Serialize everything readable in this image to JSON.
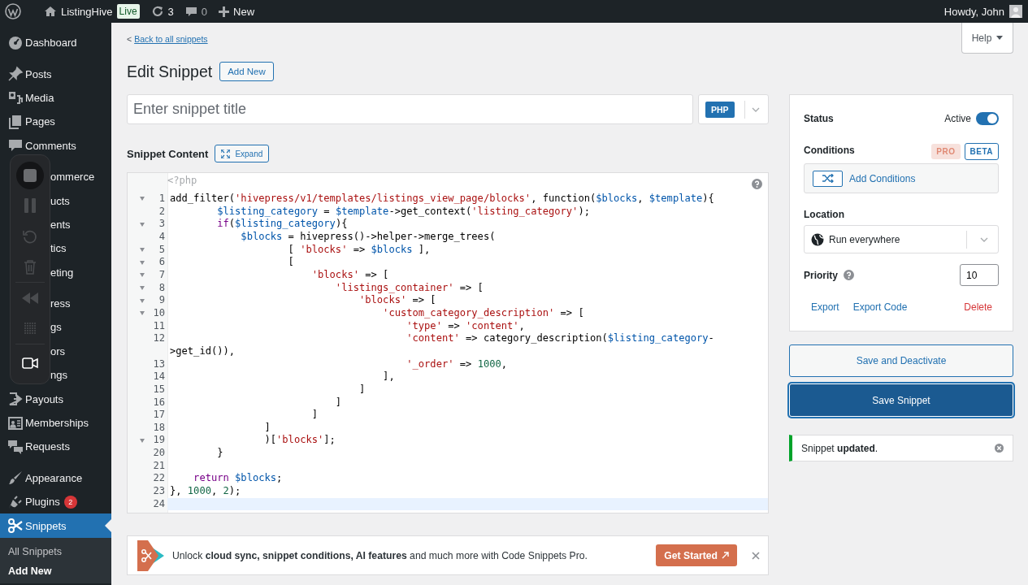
{
  "admin_bar": {
    "site_name": "ListingHive",
    "badge": "Live",
    "updates": "3",
    "comments": "0",
    "new": "New",
    "greeting": "Howdy, John"
  },
  "sidebar": {
    "groups": [
      {
        "items": [
          {
            "label": "Dashboard",
            "selected": false
          }
        ]
      },
      {
        "items": [
          {
            "label": "Posts",
            "selected": false
          },
          {
            "label": "Media",
            "selected": false
          },
          {
            "label": "Pages",
            "selected": false
          },
          {
            "label": "Comments",
            "selected": false
          }
        ]
      },
      {
        "items": [
          {
            "label": "ommerce",
            "selected": false
          },
          {
            "label": "ucts",
            "selected": false
          },
          {
            "label": "ents",
            "selected": false
          },
          {
            "label": "tics",
            "selected": false
          },
          {
            "label": "eting",
            "selected": false
          }
        ]
      },
      {
        "items": [
          {
            "label": "ress",
            "selected": false
          },
          {
            "label": "gs",
            "selected": false
          },
          {
            "label": "ors",
            "selected": false
          },
          {
            "label": "ngs",
            "selected": false
          },
          {
            "label": "Payouts",
            "selected": false
          },
          {
            "label": "Memberships",
            "selected": false
          },
          {
            "label": "Requests",
            "selected": false
          }
        ]
      },
      {
        "items": [
          {
            "label": "Appearance",
            "selected": false
          },
          {
            "label": "Plugins",
            "selected": false,
            "badge": "2"
          },
          {
            "label": "Snippets",
            "selected": true,
            "children": [
              {
                "label": "All Snippets",
                "selected": false
              },
              {
                "label": "Add New",
                "selected": true
              }
            ]
          }
        ]
      }
    ]
  },
  "header": {
    "back_prefix": "<",
    "back_link": "Back to all snippets",
    "help": "Help",
    "title": "Edit Snippet",
    "add_new": "Add New"
  },
  "title_field": {
    "placeholder": "Enter snippet title"
  },
  "type_select": {
    "value": "PHP"
  },
  "content_label": "Snippet Content",
  "expand_button": "Expand",
  "editor": {
    "opening_tag": "<?php",
    "lines": [
      {
        "num": "1",
        "fold": true,
        "current": false,
        "tokens": [
          {
            "kind": "plain",
            "text": "add_filter("
          },
          {
            "kind": "str",
            "text": "'hivepress/v1/templates/listings_view_page/blocks'"
          },
          {
            "kind": "plain",
            "text": ", function("
          },
          {
            "kind": "var",
            "text": "$blocks"
          },
          {
            "kind": "plain",
            "text": ", "
          },
          {
            "kind": "var",
            "text": "$template"
          },
          {
            "kind": "plain",
            "text": "){"
          }
        ]
      },
      {
        "num": "2",
        "fold": false,
        "current": false,
        "tokens": [
          {
            "kind": "var",
            "text": "        $listing_category"
          },
          {
            "kind": "plain",
            "text": " = "
          },
          {
            "kind": "var",
            "text": "$template"
          },
          {
            "kind": "plain",
            "text": "->get_context("
          },
          {
            "kind": "str",
            "text": "'listing_category'"
          },
          {
            "kind": "plain",
            "text": ");"
          }
        ]
      },
      {
        "num": "3",
        "fold": true,
        "current": false,
        "tokens": [
          {
            "kind": "kw",
            "text": "        if"
          },
          {
            "kind": "plain",
            "text": "("
          },
          {
            "kind": "var",
            "text": "$listing_category"
          },
          {
            "kind": "plain",
            "text": "){"
          }
        ]
      },
      {
        "num": "4",
        "fold": false,
        "current": false,
        "tokens": [
          {
            "kind": "var",
            "text": "            $blocks"
          },
          {
            "kind": "plain",
            "text": " = hivepress()->helper->merge_trees("
          }
        ]
      },
      {
        "num": "5",
        "fold": true,
        "current": false,
        "tokens": [
          {
            "kind": "plain",
            "text": "                    [ "
          },
          {
            "kind": "str",
            "text": "'blocks'"
          },
          {
            "kind": "plain",
            "text": " => "
          },
          {
            "kind": "var",
            "text": "$blocks"
          },
          {
            "kind": "plain",
            "text": " ],"
          }
        ]
      },
      {
        "num": "6",
        "fold": true,
        "current": false,
        "tokens": [
          {
            "kind": "plain",
            "text": "                    ["
          }
        ]
      },
      {
        "num": "7",
        "fold": true,
        "current": false,
        "tokens": [
          {
            "kind": "str",
            "text": "                        'blocks'"
          },
          {
            "kind": "plain",
            "text": " => ["
          }
        ]
      },
      {
        "num": "8",
        "fold": true,
        "current": false,
        "tokens": [
          {
            "kind": "str",
            "text": "                            'listings_container'"
          },
          {
            "kind": "plain",
            "text": " => ["
          }
        ]
      },
      {
        "num": "9",
        "fold": true,
        "current": false,
        "tokens": [
          {
            "kind": "str",
            "text": "                                'blocks'"
          },
          {
            "kind": "plain",
            "text": " => ["
          }
        ]
      },
      {
        "num": "10",
        "fold": true,
        "current": false,
        "tokens": [
          {
            "kind": "str",
            "text": "                                    'custom_category_description'"
          },
          {
            "kind": "plain",
            "text": " => ["
          }
        ]
      },
      {
        "num": "11",
        "fold": false,
        "current": false,
        "tokens": [
          {
            "kind": "str",
            "text": "                                        'type'"
          },
          {
            "kind": "plain",
            "text": " => "
          },
          {
            "kind": "str",
            "text": "'content'"
          },
          {
            "kind": "plain",
            "text": ","
          }
        ]
      },
      {
        "num": "12",
        "fold": false,
        "current": false,
        "tokens": [
          {
            "kind": "str",
            "text": "                                        'content'"
          },
          {
            "kind": "plain",
            "text": " => category_description("
          },
          {
            "kind": "var",
            "text": "$listing_category"
          },
          {
            "kind": "plain",
            "text": "-"
          }
        ]
      },
      {
        "fold": false,
        "current": false,
        "tokens": [
          {
            "kind": "plain",
            "text": ">get_id()),"
          }
        ]
      },
      {
        "num": "13",
        "fold": false,
        "current": false,
        "tokens": [
          {
            "kind": "str",
            "text": "                                        '_order'"
          },
          {
            "kind": "plain",
            "text": " => "
          },
          {
            "kind": "num",
            "text": "1000"
          },
          {
            "kind": "plain",
            "text": ","
          }
        ]
      },
      {
        "num": "14",
        "fold": false,
        "current": false,
        "tokens": [
          {
            "kind": "plain",
            "text": "                                    ],"
          }
        ]
      },
      {
        "num": "15",
        "fold": false,
        "current": false,
        "tokens": [
          {
            "kind": "plain",
            "text": "                                ]"
          }
        ]
      },
      {
        "num": "16",
        "fold": false,
        "current": false,
        "tokens": [
          {
            "kind": "plain",
            "text": "                            ]"
          }
        ]
      },
      {
        "num": "17",
        "fold": false,
        "current": false,
        "tokens": [
          {
            "kind": "plain",
            "text": "                        ]"
          }
        ]
      },
      {
        "num": "18",
        "fold": false,
        "current": false,
        "tokens": [
          {
            "kind": "plain",
            "text": "                ]"
          }
        ]
      },
      {
        "num": "19",
        "fold": true,
        "current": false,
        "tokens": [
          {
            "kind": "plain",
            "text": "                )["
          },
          {
            "kind": "str",
            "text": "'blocks'"
          },
          {
            "kind": "plain",
            "text": "];"
          }
        ]
      },
      {
        "num": "20",
        "fold": false,
        "current": false,
        "tokens": [
          {
            "kind": "plain",
            "text": "        }"
          }
        ]
      },
      {
        "num": "21",
        "fold": false,
        "current": false
      },
      {
        "num": "22",
        "fold": false,
        "current": false,
        "tokens": [
          {
            "kind": "kw",
            "text": "    return"
          },
          {
            "kind": "var",
            "text": " $blocks"
          },
          {
            "kind": "plain",
            "text": ";"
          }
        ]
      },
      {
        "num": "23",
        "fold": false,
        "current": false,
        "tokens": [
          {
            "kind": "plain",
            "text": "}, "
          },
          {
            "kind": "num",
            "text": "1000"
          },
          {
            "kind": "plain",
            "text": ", "
          },
          {
            "kind": "num",
            "text": "2"
          },
          {
            "kind": "plain",
            "text": ");"
          }
        ]
      },
      {
        "num": "24",
        "fold": false,
        "current": true
      }
    ]
  },
  "side_panel": {
    "status": {
      "label": "Status",
      "value_label": "Active",
      "on": true
    },
    "conditions": {
      "label": "Conditions",
      "badges": [
        {
          "label": "PRO",
          "kind": "pro"
        },
        {
          "label": "BETA",
          "kind": "beta"
        }
      ],
      "button": "Add Conditions"
    },
    "location": {
      "label": "Location",
      "value": "Run everywhere"
    },
    "priority": {
      "label": "Priority",
      "value": "10"
    },
    "actions": [
      {
        "label": "Export",
        "kind": "link"
      },
      {
        "label": "Export Code",
        "kind": "link"
      },
      {
        "label": "Delete",
        "kind": "danger"
      }
    ]
  },
  "buttons": [
    {
      "label": "Save and Deactivate",
      "kind": "secondary"
    },
    {
      "label": "Save Snippet",
      "kind": "primary"
    }
  ],
  "notice": {
    "text": "Snippet **updated**."
  },
  "banner": {
    "text": "Unlock **cloud sync, snippet conditions, AI features** and much more with Code Snippets Pro.",
    "button": "Get Started"
  }
}
